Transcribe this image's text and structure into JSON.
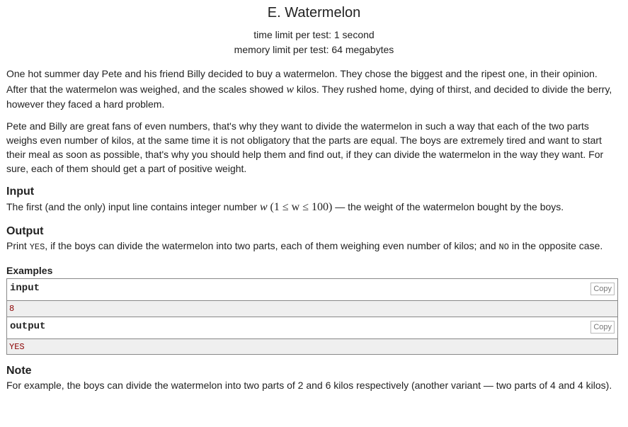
{
  "problem": {
    "title": "E. Watermelon",
    "time_limit": "time limit per test: 1 second",
    "memory_limit": "memory limit per test: 64 megabytes"
  },
  "statement": {
    "p1_line1": "One hot summer day Pete and his friend Billy decided to buy a watermelon. They chose the biggest and the ripest one, in their opinion.",
    "p1_line2_before": "After that the watermelon was weighed, and the scales showed ",
    "var_w": "w",
    "p1_line2_after": " kilos. They rushed home, dying of thirst, and decided to divide the berry,",
    "p1_line3": "however they faced a hard problem.",
    "p2": "Pete and Billy are great fans of even numbers, that's why they want to divide the watermelon in such a way that each of the two parts weighs even number of kilos, at the same time it is not obligatory that the parts are equal. The boys are extremely tired and want to start their meal as soon as possible, that's why you should help them and find out, if they can divide the watermelon in the way they want. For sure, each of them should get a part of positive weight."
  },
  "input_section": {
    "heading": "Input",
    "text_before": "The first (and the only) input line contains integer number ",
    "math_constraint": "(1 ≤ w ≤ 100)",
    "text_after": " — the weight of the watermelon bought by the boys."
  },
  "output_section": {
    "heading": "Output",
    "text_before": "Print ",
    "yes_token": "YES",
    "text_middle": ", if the boys can divide the watermelon into two parts, each of them weighing even number of kilos; and ",
    "no_token": "NO",
    "text_after": " in the opposite case."
  },
  "examples": {
    "heading": "Examples",
    "input_label": "input",
    "output_label": "output",
    "copy_label": "Copy",
    "input_value": "8",
    "output_value": "YES"
  },
  "note": {
    "heading": "Note",
    "text": "For example, the boys can divide the watermelon into two parts of 2 and 6 kilos respectively (another variant — two parts of 4 and 4 kilos)."
  }
}
